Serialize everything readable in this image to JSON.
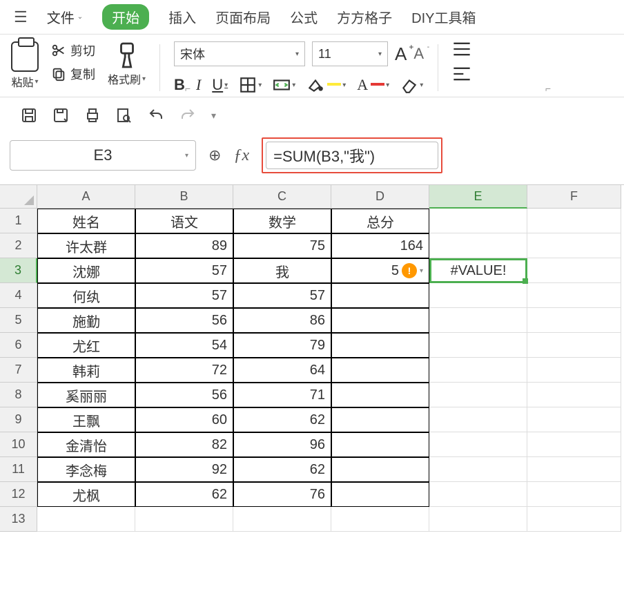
{
  "menu": {
    "file": "文件",
    "start": "开始",
    "insert": "插入",
    "layout": "页面布局",
    "formula": "公式",
    "ffgz": "方方格子",
    "diy": "DIY工具箱"
  },
  "ribbon": {
    "paste": "粘贴",
    "cut": "剪切",
    "copy": "复制",
    "brush": "格式刷",
    "font_name": "宋体",
    "font_size": "11"
  },
  "namebox": "E3",
  "formula": "=SUM(B3,\"我\")",
  "columns": [
    "A",
    "B",
    "C",
    "D",
    "E",
    "F"
  ],
  "chart_data": {
    "type": "table",
    "headers": [
      "姓名",
      "语文",
      "数学",
      "总分"
    ],
    "rows": [
      [
        "许太群",
        "89",
        "75",
        "164"
      ],
      [
        "沈娜",
        "57",
        "我",
        "5",
        ""
      ],
      [
        "何纨",
        "57",
        "57",
        "",
        ""
      ],
      [
        "施勤",
        "56",
        "86",
        "",
        ""
      ],
      [
        "尤红",
        "54",
        "79",
        "",
        ""
      ],
      [
        "韩莉",
        "72",
        "64",
        "",
        ""
      ],
      [
        "奚丽丽",
        "56",
        "71",
        "",
        ""
      ],
      [
        "王飘",
        "60",
        "62",
        "",
        ""
      ],
      [
        "金清怡",
        "82",
        "96",
        "",
        ""
      ],
      [
        "李念梅",
        "92",
        "62",
        "",
        ""
      ],
      [
        "尤枫",
        "62",
        "76",
        "",
        ""
      ]
    ]
  },
  "error_cell": "#VALUE!",
  "warn_d3": "5"
}
